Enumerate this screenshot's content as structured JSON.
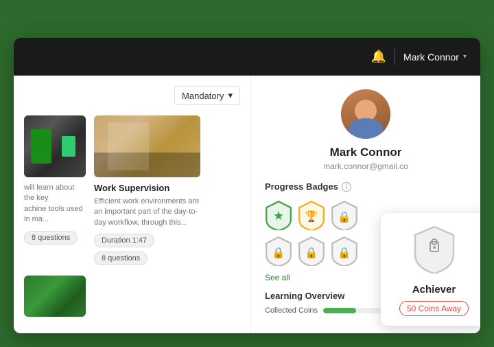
{
  "navbar": {
    "username": "Mark Connor",
    "chevron": "▾"
  },
  "filter": {
    "label": "Mandatory",
    "chevron": "▾"
  },
  "courses": [
    {
      "id": "partial",
      "desc_short": "will learn about the key\nachine tools used in ma...",
      "questions": "8 questions"
    },
    {
      "id": "work-supervision",
      "title": "Work Supervision",
      "desc": "Efficient work environments are an important part of the day-to-day workflow, through this...",
      "duration": "Duration 1:47",
      "questions": "8 questions"
    }
  ],
  "profile": {
    "name": "Mark Connor",
    "email": "mark.connor@gmail.co",
    "badges_label": "Progress Badges",
    "see_all": "See all",
    "learning_label": "Learning Overview",
    "collected_coins": "Collected Coins"
  },
  "achiever": {
    "name": "Achiever",
    "coins_away": "50 Coins Away"
  },
  "icons": {
    "bell": "🔔",
    "info": "i",
    "lock": "🔒"
  }
}
